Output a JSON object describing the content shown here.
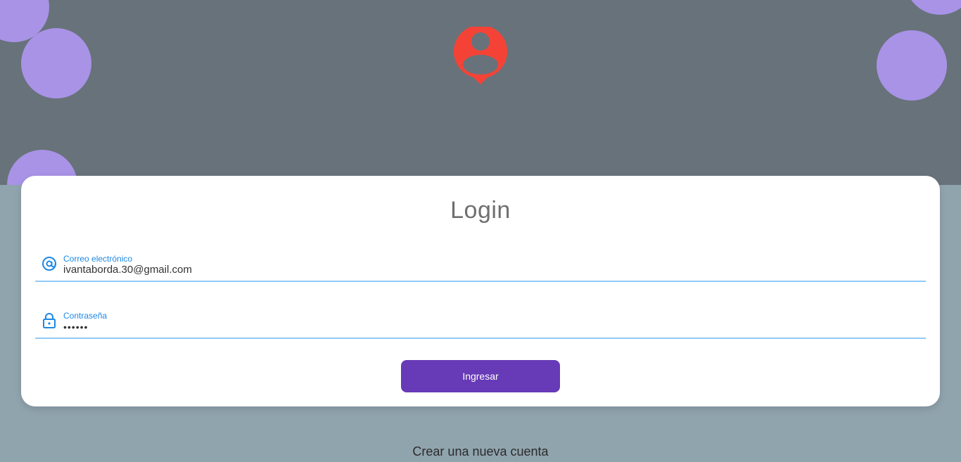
{
  "app": {
    "logo_icon": "account-pin-icon",
    "logo_color": "#f44336",
    "accent_color": "#673ab7",
    "bubble_color": "#a893e6"
  },
  "login": {
    "title": "Login",
    "email": {
      "label": "Correo electrónico",
      "value": "ivantaborda.30@gmail.com",
      "icon": "at-sign-icon"
    },
    "password": {
      "label": "Contraseña",
      "value": "••••••",
      "icon": "lock-icon"
    },
    "submit_label": "Ingresar",
    "create_account_label": "Crear una nueva cuenta"
  }
}
